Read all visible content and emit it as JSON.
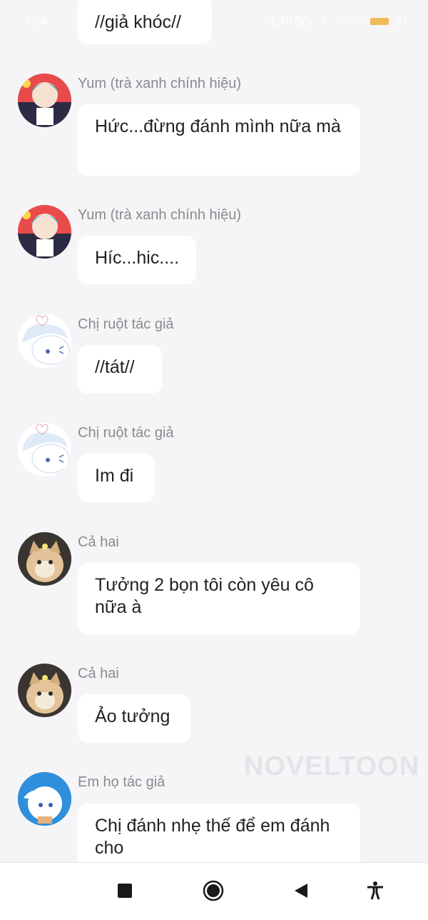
{
  "status_bar": {
    "time": "7:04",
    "speed": "1,7KB/s",
    "battery": "97"
  },
  "messages": [
    {
      "sender": "",
      "text": "//giả khóc//"
    },
    {
      "sender": "Yum (trà xanh chính hiệu)",
      "text": "Hức...đừng đánh mình nữa mà"
    },
    {
      "sender": "Yum (trà xanh chính hiệu)",
      "text": "Híc...hic...."
    },
    {
      "sender": "Chị ruột tác giả",
      "text": "//tát//"
    },
    {
      "sender": "Chị ruột tác giả",
      "text": "Im đi"
    },
    {
      "sender": "Cả hai",
      "text": "Tưởng 2 bọn tôi còn yêu cô nữa à"
    },
    {
      "sender": "Cả hai",
      "text": "Ảo tưởng"
    },
    {
      "sender": "Em họ tác giả",
      "text": "Chị đánh nhẹ thế để em đánh cho"
    }
  ],
  "watermark": "NOVELTOON",
  "nav": {
    "icons": [
      "stop-square-icon",
      "home-circle-icon",
      "back-triangle-icon",
      "accessibility-icon"
    ]
  },
  "colors": {
    "background": "#f5f5f7",
    "bubble": "#ffffff",
    "sender": "#8a8a8f",
    "text": "#222222"
  }
}
